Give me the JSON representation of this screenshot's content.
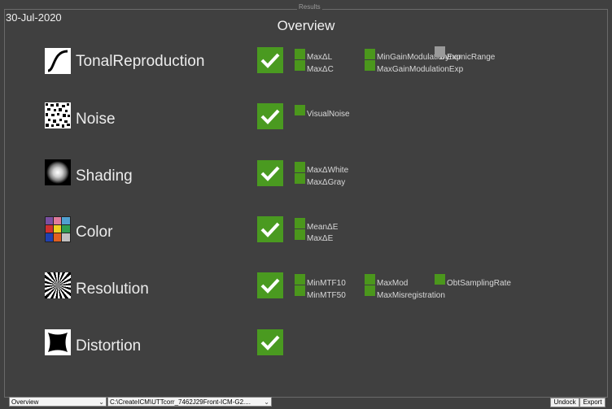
{
  "frame_label": "Results",
  "date": "30-Jul-2020",
  "title": "Overview",
  "categories": [
    {
      "label": "TonalReproduction",
      "icon": "tone-curve-icon"
    },
    {
      "label": "Noise",
      "icon": "noise-pattern-icon"
    },
    {
      "label": "Shading",
      "icon": "shading-gradient-icon"
    },
    {
      "label": "Color",
      "icon": "color-checker-icon"
    },
    {
      "label": "Resolution",
      "icon": "siemens-star-icon"
    },
    {
      "label": "Distortion",
      "icon": "distortion-icon"
    }
  ],
  "metrics": {
    "tonal": [
      "MaxΔL",
      "MaxΔC",
      "MinGainModulationExp",
      "MaxGainModulationExp",
      "DynamicRange"
    ],
    "noise": [
      "VisualNoise"
    ],
    "shading": [
      "MaxΔWhite",
      "MaxΔGray"
    ],
    "color": [
      "MeanΔE",
      "MaxΔE"
    ],
    "resolution": [
      "MinMTF10",
      "MinMTF50",
      "MaxMod",
      "MaxMisregistration",
      "ObtSamplingRate"
    ]
  },
  "status_colors": {
    "pass": "#4b971c",
    "not_evaluated": "#9a9a9a"
  },
  "footer": {
    "view_select": "Overview",
    "path_select": "C:\\CreateICM\\UTTcorr_7462J29Front-ICM-G2....",
    "undock": "Undock",
    "export": "Export"
  }
}
